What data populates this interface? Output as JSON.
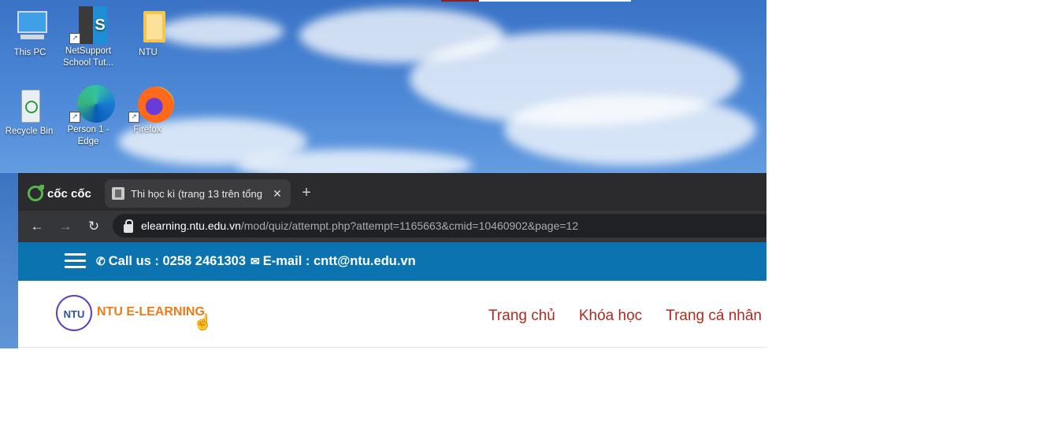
{
  "desktop": {
    "icons": [
      {
        "label": "This PC",
        "icon": "computer-icon"
      },
      {
        "label": "NetSupport School Tut...",
        "icon": "netsupport-icon"
      },
      {
        "label": "NTU",
        "icon": "folder-icon"
      },
      {
        "label": "Recycle Bin",
        "icon": "recycle-bin-icon"
      },
      {
        "label": "Person 1 - Edge",
        "icon": "edge-icon"
      },
      {
        "label": "Firefox",
        "icon": "firefox-icon"
      }
    ]
  },
  "browser": {
    "brand": "cốc cốc",
    "tab": {
      "title": "Thi học kì (trang 13 trên tổng"
    },
    "url": {
      "host": "elearning.ntu.edu.vn",
      "path": "/mod/quiz/attempt.php?attempt=1165663&cmid=10460902&page=12"
    }
  },
  "page": {
    "topbar": {
      "phone": "Call us : 0258 2461303",
      "email": "E-mail : cntt@ntu.edu.vn"
    },
    "logo": {
      "seal": "NTU",
      "text": "NTU E-LEARNING"
    },
    "menu": [
      "Trang chủ",
      "Khóa học",
      "Trang cá nhân"
    ]
  },
  "colors": {
    "topbar": "#0b73b0",
    "menu_link": "#b12a1f",
    "logo_text": "#f07a18"
  }
}
